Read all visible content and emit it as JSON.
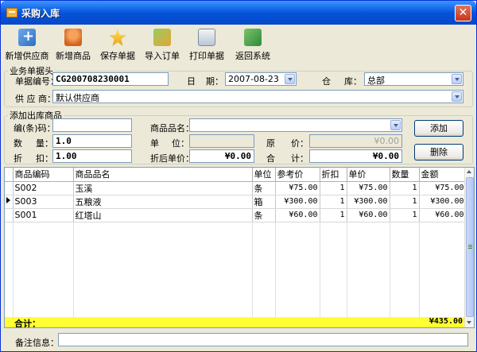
{
  "window": {
    "title": "采购入库"
  },
  "toolbar": [
    {
      "label": "新增供应商",
      "icon": "add-supplier-icon"
    },
    {
      "label": "新增商品",
      "icon": "add-product-icon"
    },
    {
      "label": "保存单据",
      "icon": "save-icon"
    },
    {
      "label": "导入订单",
      "icon": "import-icon"
    },
    {
      "label": "打印单据",
      "icon": "print-icon"
    },
    {
      "label": "返回系统",
      "icon": "exit-icon"
    }
  ],
  "header_group": {
    "legend": "业务单据头",
    "doc_no_label": "单据编号：",
    "doc_no": "CG200708230001",
    "date_label_1": "日",
    "date_label_2": "期：",
    "date": "2007-08-23",
    "warehouse_label_1": "仓",
    "warehouse_label_2": "库：",
    "warehouse": "总部",
    "supplier_label": "供 应 商：",
    "supplier": "默认供应商"
  },
  "add_group": {
    "legend": "添加出库商品",
    "code_label": "编(条)码：",
    "code": "",
    "name_label": "商品品名：",
    "name": "",
    "qty_label_1": "数",
    "qty_label_2": "量：",
    "qty": "1.0",
    "unit_label_1": "单",
    "unit_label_2": "位：",
    "unit": "",
    "orig_price_label_1": "原",
    "orig_price_label_2": "价：",
    "orig_price": "¥0.00",
    "discount_label_1": "折",
    "discount_label_2": "扣：",
    "discount": "1.00",
    "disc_price_label": "折后单价：",
    "disc_price": "¥0.00",
    "total_label_1": "合",
    "total_label_2": "计：",
    "total": "¥0.00",
    "add_button": "添加",
    "delete_button": "删除"
  },
  "grid": {
    "columns": [
      "商品编码",
      "商品品名",
      "单位",
      "参考价",
      "折扣",
      "单价",
      "数量",
      "金额"
    ],
    "rows": [
      {
        "code": "S002",
        "name": "玉溪",
        "unit": "条",
        "ref_price": "¥75.00",
        "discount": "1",
        "price": "¥75.00",
        "qty": "1",
        "amount": "¥75.00"
      },
      {
        "code": "S003",
        "name": "五粮液",
        "unit": "箱",
        "ref_price": "¥300.00",
        "discount": "1",
        "price": "¥300.00",
        "qty": "1",
        "amount": "¥300.00"
      },
      {
        "code": "S001",
        "name": "红塔山",
        "unit": "条",
        "ref_price": "¥60.00",
        "discount": "1",
        "price": "¥60.00",
        "qty": "1",
        "amount": "¥60.00"
      }
    ],
    "total_label": "合计：",
    "total_amount": "¥435.00"
  },
  "footer": {
    "remark_label": "备注信息：",
    "remark": ""
  }
}
